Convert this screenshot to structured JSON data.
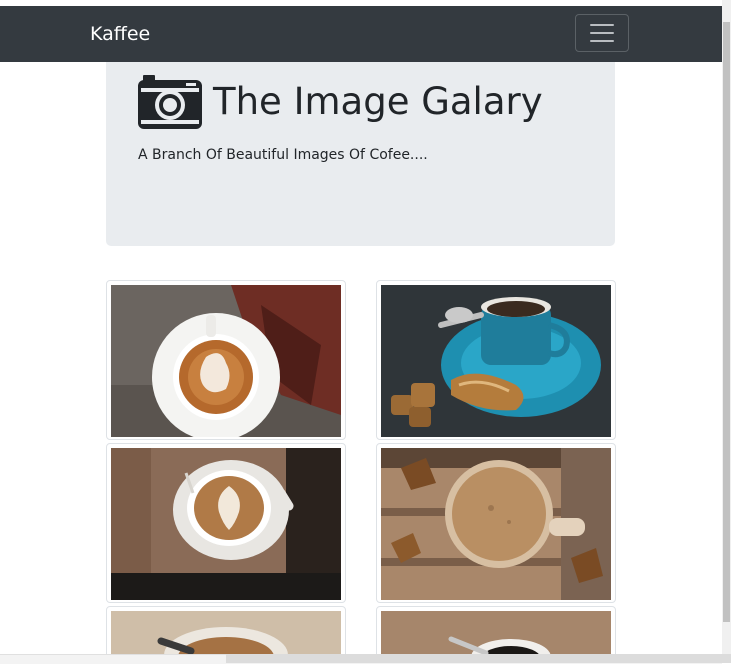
{
  "navbar": {
    "brand": "Kaffee",
    "toggler_icon": "hamburger-menu-icon"
  },
  "jumbotron": {
    "icon": "camera-icon",
    "title": "The Image Galary",
    "subtitle": "A Branch Of Beautiful Images Of Cofee...."
  },
  "gallery": {
    "images": [
      {
        "subject": "latte art ghost on white saucer with autumn leaf"
      },
      {
        "subject": "espresso in teal cup with biscotti"
      },
      {
        "subject": "latte art heart on wooden table"
      },
      {
        "subject": "coffee mug top view on rustic wood with leaves"
      },
      {
        "subject": "coffee cup partially visible"
      },
      {
        "subject": "black coffee with spoon partially visible"
      }
    ]
  },
  "colors": {
    "navbar_bg": "#343a40",
    "jumbotron_bg": "#e9ecef",
    "text": "#212529"
  }
}
